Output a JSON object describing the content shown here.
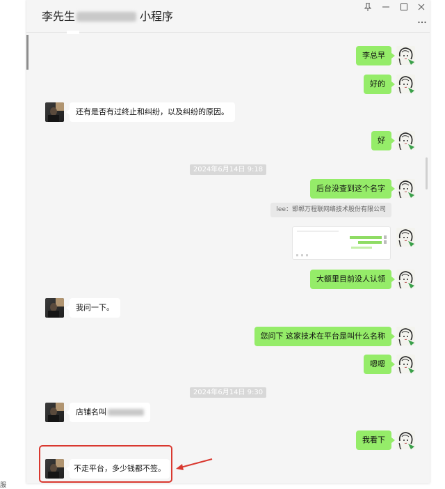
{
  "window": {
    "title": "李先生",
    "title_suffix": "小程序",
    "icons": {
      "pin": "pin-icon",
      "minimize": "minimize-icon",
      "maximize": "maximize-icon",
      "close": "close-icon",
      "more": "more-icon"
    }
  },
  "colors": {
    "sent_bubble": "#95ec69",
    "received_bubble": "#ffffff",
    "chat_background": "#f5f5f5",
    "highlight": "#d9382f"
  },
  "timestamps": [
    "2024年6月14日 9:18",
    "2024年6月14日 9:30"
  ],
  "quote": "lee：邯郸万程联网络技术股份有限公司",
  "messages": [
    "李总早",
    "好的",
    "还有是否有过终止和纠纷，以及纠纷的原因。",
    "好",
    "后台没查到这个名字",
    "大额里目前没人认领",
    "我问一下。",
    "您问下 这家技术在平台是叫什么名称",
    "嗯嗯",
    "店铺名叫",
    "我看下",
    "不走平台，多少钱都不签。"
  ],
  "footer": {
    "partial_text": "服"
  }
}
